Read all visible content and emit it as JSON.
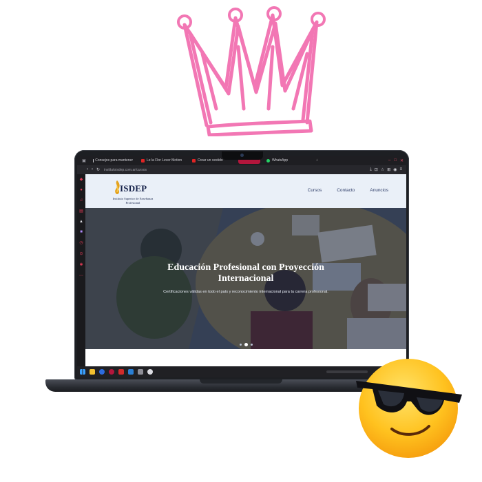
{
  "browser": {
    "tabs": [
      {
        "label": "Consejos para mantener",
        "favicon_color": "#cfcfd4"
      },
      {
        "label": "Le la Flor Lever Motion",
        "favicon_color": "#e02424"
      },
      {
        "label": "Crear un vestido",
        "favicon_color": "#e02424"
      },
      {
        "label": "",
        "favicon_color": "#b3163c"
      },
      {
        "label": "WhatsApp",
        "favicon_color": "#25d366"
      }
    ],
    "url": "institutoisdep.com.ar/cursos"
  },
  "site": {
    "logo_name": "ISDEP",
    "logo_subtitle": "Instituto Superior de Enseñanza Profesional",
    "nav": [
      "Cursos",
      "Contacto",
      "Anuncios"
    ],
    "hero_title": "Educación Profesional con Proyección Internacional",
    "hero_subtitle": "Certificaciones válidas en todo el país y reconocimiento internacional para tu carrera profesional.",
    "carousel_slide_count": 3,
    "carousel_active_slide": 2
  },
  "colors": {
    "crown": "#f277b4",
    "browser_accent": "#b3163c",
    "header_bg": "#eaf0f8",
    "brand_navy": "#16224a"
  },
  "icons": {
    "decoration_top": "crown-doodle",
    "decoration_bottom": "sunglasses-emoji"
  }
}
